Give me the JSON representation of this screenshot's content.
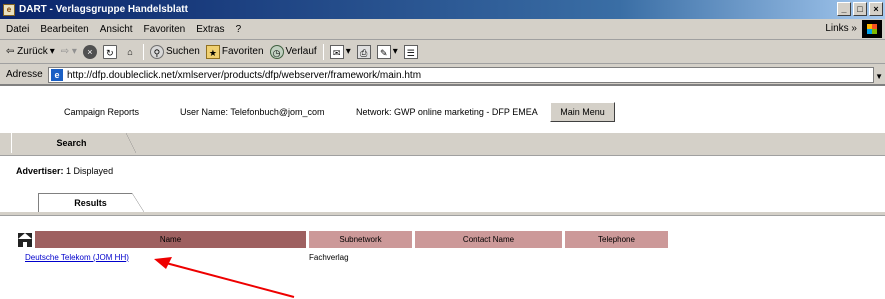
{
  "window": {
    "title": "DART - Verlagsgruppe Handelsblatt",
    "buttons": [
      "_",
      "□",
      "×"
    ]
  },
  "menubar": {
    "items": [
      "Datei",
      "Bearbeiten",
      "Ansicht",
      "Favoriten",
      "Extras",
      "?"
    ],
    "links": "Links »"
  },
  "toolbar": {
    "back": "⇦ Zurück",
    "search": "Suchen",
    "favorites": "Favoriten",
    "history": "Verlauf"
  },
  "addressbar": {
    "label": "Adresse",
    "url": "http://dfp.doubleclick.net/xmlserver/products/dfp/webserver/framework/main.htm"
  },
  "header": {
    "campaign_reports": "Campaign Reports",
    "user_name": "User Name: Telefonbuch@jom_com",
    "network": "Network: GWP online marketing - DFP EMEA",
    "main_menu_button": "Main Menu"
  },
  "search_tab": "Search",
  "advertiser_label": "Advertiser:",
  "advertiser_count": "1 Displayed",
  "results_tab": "Results",
  "table": {
    "columns": [
      "Name",
      "Subnetwork",
      "Contact Name",
      "Telephone"
    ],
    "rows": [
      {
        "name": "Deutsche Telekom (JOM HH)",
        "subnetwork": "Fachverlag",
        "contact": "",
        "telephone": ""
      }
    ]
  },
  "colors": {
    "arrow": "#ee0000",
    "header_dark": "#9e6060",
    "header_light": "#cc9999",
    "link": "#0000cc"
  },
  "icons": {
    "home": "home-icon",
    "arrow": "red-arrow-annotation"
  }
}
